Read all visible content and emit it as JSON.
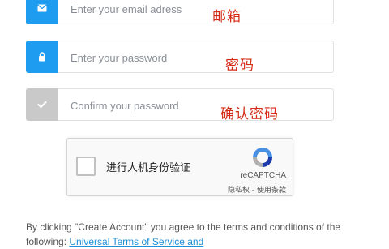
{
  "form": {
    "email": {
      "placeholder": "Enter your email adress",
      "icon": "envelope-icon",
      "icon_bg": "#1e9cf0",
      "annotation": "邮箱"
    },
    "password": {
      "placeholder": "Enter your password",
      "icon": "lock-icon",
      "icon_bg": "#1e9cf0",
      "annotation": "密码"
    },
    "confirm_password": {
      "placeholder": "Confirm your password",
      "icon": "check-icon",
      "icon_bg": "#c9c9c9",
      "annotation": "确认密码"
    }
  },
  "recaptcha": {
    "label": "进行人机身份验证",
    "brand": "reCAPTCHA",
    "links": "隐私权 - 使用条款"
  },
  "terms": {
    "text": "By clicking \"Create Account\" you agree to the terms and conditions of the following: ",
    "link_text": "Universal Terms of Service and"
  },
  "colors": {
    "accent": "#1e9cf0",
    "annotation": "#d42a14",
    "link": "#1e90d8"
  }
}
